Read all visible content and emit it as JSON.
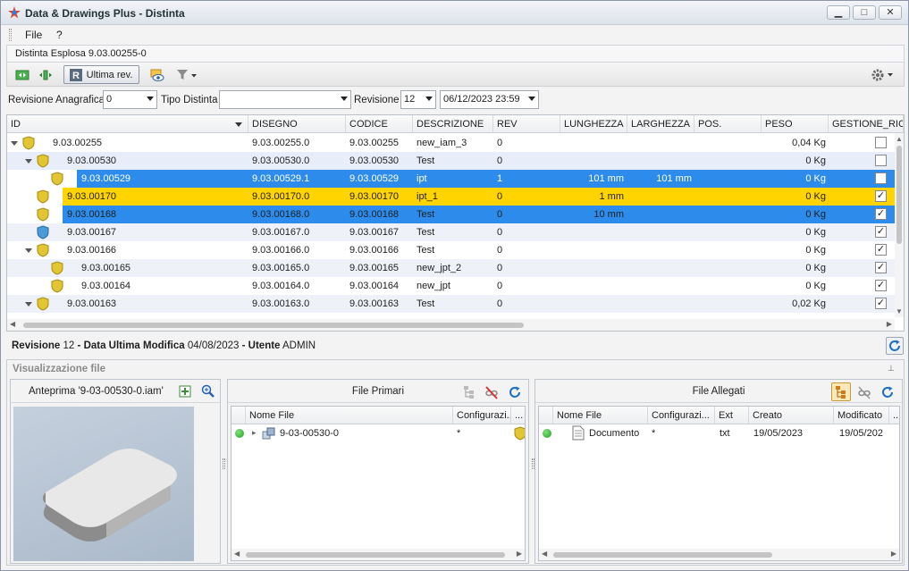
{
  "window": {
    "title": "Data & Drawings Plus - Distinta",
    "minimize": "▁",
    "maximize": "□",
    "close": "✕"
  },
  "menu": {
    "file": "File",
    "help": "?"
  },
  "bom_title": "Distinta Esplosa 9.03.00255-0",
  "toolbar": {
    "ultima_rev": "Ultima rev."
  },
  "filters": {
    "rev_anagrafica_label": "Revisione Anagrafica",
    "rev_anagrafica_value": "0",
    "tipo_distinta_label": "Tipo Distinta",
    "tipo_distinta_value": "",
    "revisione_label": "Revisione",
    "revisione_value": "12",
    "date_value": "06/12/2023 23:59"
  },
  "grid": {
    "columns": [
      "ID",
      "DISEGNO",
      "CODICE",
      "DESCRIZIONE",
      "REV",
      "LUNGHEZZA",
      "LARGHEZZA",
      "POS.",
      "PESO",
      "GESTIONE_RICA"
    ],
    "rows": [
      {
        "id": "9.03.00255",
        "disegno": "9.03.00255.0",
        "codice": "9.03.00255",
        "descrizione": "new_iam_3",
        "rev": "0",
        "lunghezza": "",
        "larghezza": "",
        "peso": "0,04 Kg",
        "checked": false
      },
      {
        "id": "9.03.00530",
        "disegno": "9.03.00530.0",
        "codice": "9.03.00530",
        "descrizione": "Test",
        "rev": "0",
        "lunghezza": "",
        "larghezza": "",
        "peso": "0 Kg",
        "checked": false
      },
      {
        "id": "9.03.00529",
        "disegno": "9.03.00529.1",
        "codice": "9.03.00529",
        "descrizione": "ipt",
        "rev": "1",
        "lunghezza": "101 mm",
        "larghezza": "101 mm",
        "peso": "0 Kg",
        "checked": false
      },
      {
        "id": "9.03.00170",
        "disegno": "9.03.00170.0",
        "codice": "9.03.00170",
        "descrizione": "ipt_1",
        "rev": "0",
        "lunghezza": "1 mm",
        "larghezza": "",
        "peso": "0 Kg",
        "checked": true
      },
      {
        "id": "9.03.00168",
        "disegno": "9.03.00168.0",
        "codice": "9.03.00168",
        "descrizione": "Test",
        "rev": "0",
        "lunghezza": "10 mm",
        "larghezza": "",
        "peso": "0 Kg",
        "checked": true
      },
      {
        "id": "9.03.00167",
        "disegno": "9.03.00167.0",
        "codice": "9.03.00167",
        "descrizione": "Test",
        "rev": "0",
        "lunghezza": "",
        "larghezza": "",
        "peso": "0 Kg",
        "checked": true
      },
      {
        "id": "9.03.00166",
        "disegno": "9.03.00166.0",
        "codice": "9.03.00166",
        "descrizione": "Test",
        "rev": "0",
        "lunghezza": "",
        "larghezza": "",
        "peso": "0 Kg",
        "checked": true
      },
      {
        "id": "9.03.00165",
        "disegno": "9.03.00165.0",
        "codice": "9.03.00165",
        "descrizione": "new_jpt_2",
        "rev": "0",
        "lunghezza": "",
        "larghezza": "",
        "peso": "0 Kg",
        "checked": true
      },
      {
        "id": "9.03.00164",
        "disegno": "9.03.00164.0",
        "codice": "9.03.00164",
        "descrizione": "new_jpt",
        "rev": "0",
        "lunghezza": "",
        "larghezza": "",
        "peso": "0 Kg",
        "checked": true
      },
      {
        "id": "9.03.00163",
        "disegno": "9.03.00163.0",
        "codice": "9.03.00163",
        "descrizione": "Test",
        "rev": "0",
        "lunghezza": "",
        "larghezza": "",
        "peso": "0,02 Kg",
        "checked": true
      }
    ]
  },
  "status": {
    "rev_label": "Revisione",
    "rev_value": "12",
    "date_label": "Data Ultima Modifica",
    "date_value": "04/08/2023",
    "user_label": "Utente",
    "user_value": "ADMIN"
  },
  "files": {
    "title": "Visualizzazione file",
    "preview_title": "Anteprima '9-03-00530-0.iam'",
    "primary": {
      "title": "File Primari",
      "col_name": "Nome File",
      "col_config": "Configurazi...",
      "col_more": "...",
      "row_name": "9-03-00530-0",
      "row_config": "*"
    },
    "attached": {
      "title": "File Allegati",
      "col_name": "Nome File",
      "col_config": "Configurazi...",
      "col_ext": "Ext",
      "col_created": "Creato",
      "col_modified": "Modificato",
      "col_more": "...",
      "row_name": "Documento",
      "row_config": "*",
      "row_ext": "txt",
      "row_created": "19/05/2023",
      "row_modified": "19/05/202"
    }
  }
}
